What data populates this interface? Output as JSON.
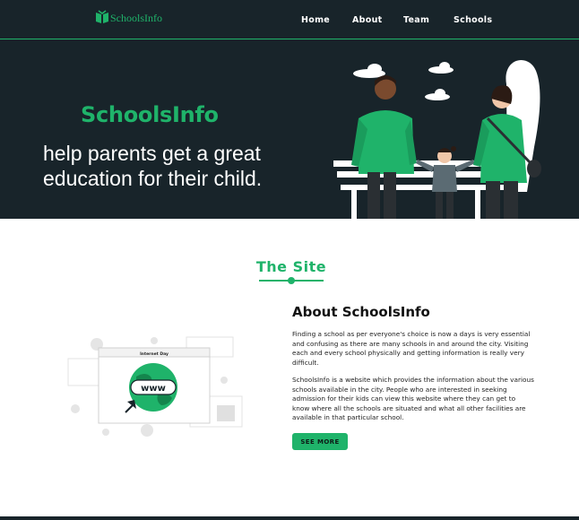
{
  "brand": {
    "logo_text": "SchoolsInfo",
    "accent_color": "#1fb36a",
    "dark_color": "#18242a"
  },
  "nav": {
    "items": [
      {
        "label": "Home"
      },
      {
        "label": "About"
      },
      {
        "label": "Team"
      },
      {
        "label": "Schools"
      }
    ]
  },
  "hero": {
    "title": "SchoolsInfo",
    "tagline": "help parents get a great education for their child.",
    "illustration": "family-walking-illustration"
  },
  "section": {
    "title": "The Site"
  },
  "about": {
    "heading": "About SchoolsInfo",
    "paragraph1": "Finding a school as per everyone's choice is now a days is very essential and confusing as there are many schools in and around the city. Visiting each and every school physically and getting information is really very difficult.",
    "paragraph2": "SchoolsInfo is a website which provides the information about the various schools available in the city. People who are interested in seeking admission for their kids can view this website where they can get to know where all the schools are situated and what all other facilities are available in that particular school.",
    "button_label": "SEE MORE",
    "illustration": {
      "browser_title": "Internet Day",
      "globe_text": "www"
    }
  }
}
